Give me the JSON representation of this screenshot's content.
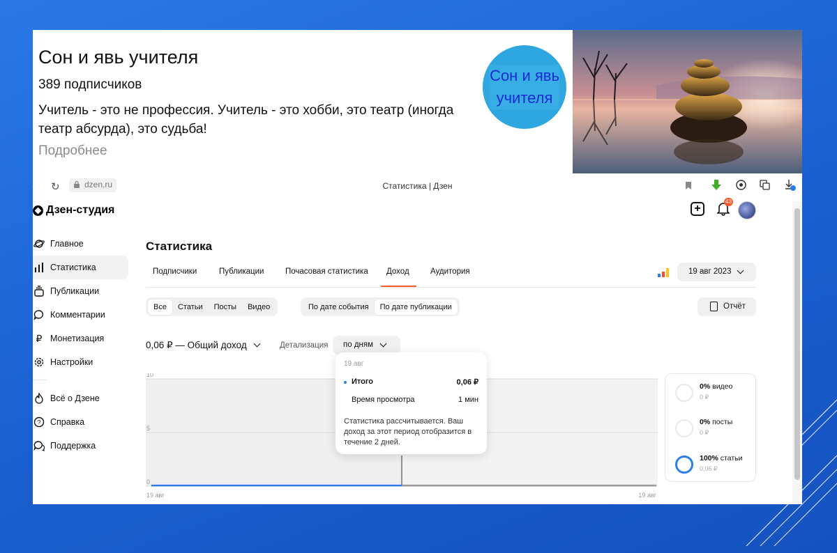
{
  "channel": {
    "title": "Сон и явь учителя",
    "subscribers_count": "389",
    "subscribers_label": "подписчиков",
    "description": "Учитель - это не профессия. Учитель - это хобби, это театр (иногда театр абсурда), это судьба!",
    "more_link": "Подробнее",
    "avatar_text_line1": "Сон и явь",
    "avatar_text_line2": "учителя"
  },
  "browser": {
    "url": "dzen.ru",
    "page_title": "Статистика | Дзен"
  },
  "studio": {
    "logo": "Дзен-студия",
    "notifications_count": "43",
    "sidebar": [
      {
        "label": "Главное",
        "icon": "planet-icon"
      },
      {
        "label": "Статистика",
        "icon": "bar-chart-icon",
        "active": true
      },
      {
        "label": "Публикации",
        "icon": "stack-icon"
      },
      {
        "label": "Комментарии",
        "icon": "comment-icon"
      },
      {
        "label": "Монетизация",
        "icon": "ruble-icon"
      },
      {
        "label": "Настройки",
        "icon": "gear-icon"
      }
    ],
    "sidebar_bottom": [
      {
        "label": "Всё о Дзене",
        "icon": "flame-icon"
      },
      {
        "label": "Справка",
        "icon": "help-icon"
      },
      {
        "label": "Поддержка",
        "icon": "chat-icon"
      }
    ]
  },
  "stats": {
    "title": "Статистика",
    "tabs": [
      "Подписчики",
      "Публикации",
      "Почасовая статистика",
      "Доход",
      "Аудитория"
    ],
    "active_tab": "Доход",
    "date_selector": "19 авг 2023",
    "content_filters": [
      "Все",
      "Статьи",
      "Посты",
      "Видео"
    ],
    "date_filters": [
      "По дате события",
      "По дате публикации"
    ],
    "report_button": "Отчёт",
    "income_summary": "0,06 ₽ — Общий доход",
    "detail_label": "Детализация",
    "detail_value": "по дням",
    "tooltip": {
      "date": "19 авг",
      "total_label": "Итого",
      "total_value": "0,06 ₽",
      "watch_label": "Время просмотра",
      "watch_value": "1 мин",
      "note": "Статистика рассчитывается. Ваш доход за этот период отобразится в течение 2 дней."
    },
    "breakdown": [
      {
        "percent": "0%",
        "type": "видео",
        "amount": "0 ₽",
        "fraction": 0
      },
      {
        "percent": "0%",
        "type": "посты",
        "amount": "0 ₽",
        "fraction": 0
      },
      {
        "percent": "100%",
        "type": "статьи",
        "amount": "0,06 ₽",
        "fraction": 1
      }
    ]
  },
  "colors": {
    "accent": "#ff5a2b",
    "blue": "#2b7de9",
    "background": "#1a66d9"
  },
  "chart_data": {
    "type": "line",
    "x": [
      "19 авг",
      "19 авг"
    ],
    "y_ticks": [
      0,
      5,
      10
    ],
    "ylim": [
      0,
      10
    ],
    "series": [
      {
        "values": [
          0.06,
          0.06
        ]
      }
    ],
    "x_tick_labels": [
      "19 авг",
      "19 авг"
    ]
  }
}
